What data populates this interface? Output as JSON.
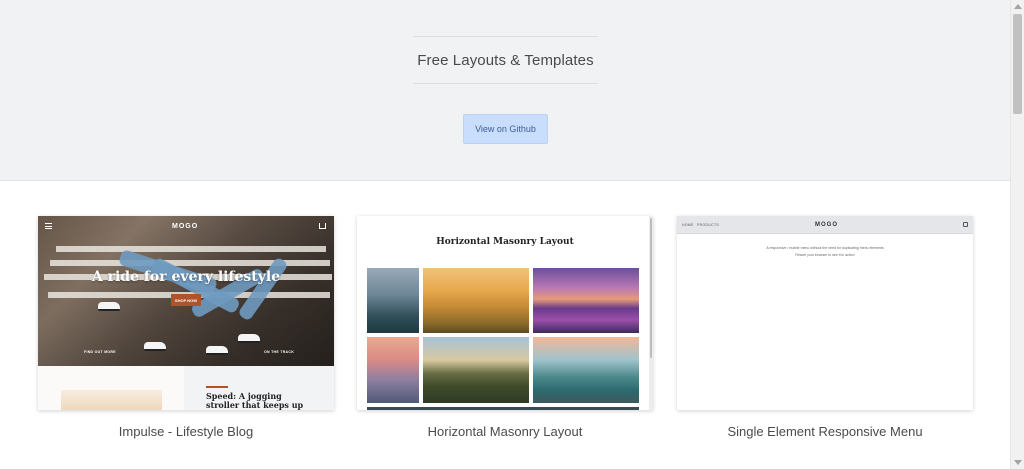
{
  "hero": {
    "title": "Free Layouts & Templates",
    "button_label": "View on Github"
  },
  "cards": [
    {
      "caption": "Impulse - Lifestyle Blog",
      "preview": {
        "logo": "MOGO",
        "headline": "A ride for every lifestyle",
        "shop_label": "SHOP NOW",
        "left_link": "FIND OUT MORE",
        "right_link": "ON THE TRACK",
        "article_title": "Speed: A jogging stroller that keeps up with you"
      }
    },
    {
      "caption": "Horizontal Masonry Layout",
      "preview": {
        "title": "Horizontal Masonry Layout"
      }
    },
    {
      "caption": "Single Element Responsive Menu",
      "preview": {
        "nav_home": "HOME",
        "nav_products": "PRODUCTS",
        "logo": "MOGO",
        "line1": "A responsive / mobile menu without the need for duplicating menu elements",
        "line2": "Resize your browser to see it in action"
      }
    }
  ],
  "colors": {
    "hero_bg": "#f1f2f4",
    "button_bg": "#c9defc",
    "button_text": "#3d5f8f",
    "accent_orange": "#b0532a"
  },
  "icons": {
    "menu": "hamburger-icon",
    "cart": "cart-icon"
  }
}
